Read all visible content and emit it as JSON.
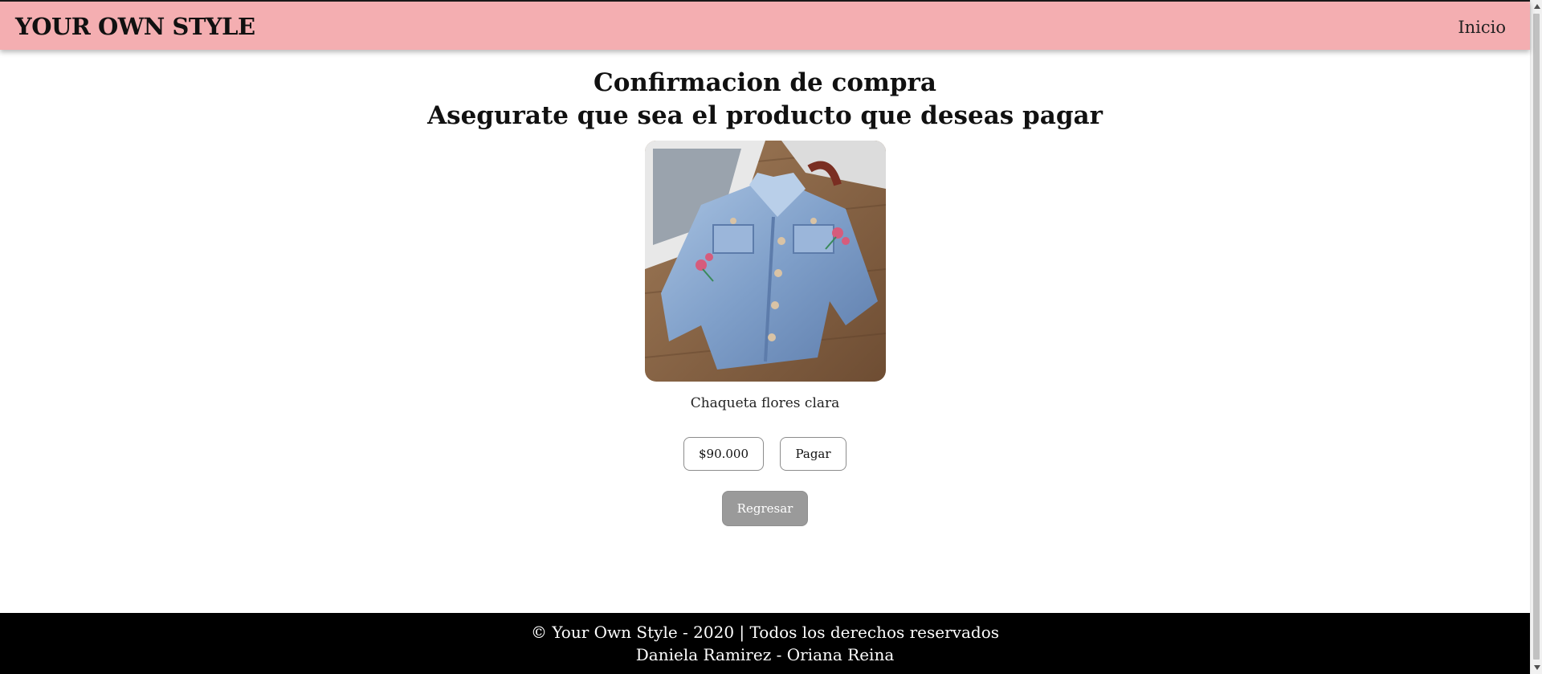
{
  "navbar": {
    "brand": "YOUR OWN STYLE",
    "link_home": "Inicio",
    "background_color": "#f4aeb1"
  },
  "main": {
    "title": "Confirmacion de compra",
    "subtitle": "Asegurate que sea el producto que deseas pagar",
    "product": {
      "name": "Chaqueta flores clara",
      "price": "$90.000",
      "image_icon": "denim-jacket-photo"
    },
    "buttons": {
      "pay": "Pagar",
      "back": "Regresar"
    }
  },
  "footer": {
    "line1": "© Your Own Style - 2020 | Todos los derechos reservados",
    "line2": "Daniela Ramirez - Oriana Reina",
    "background_color": "#000000"
  },
  "scrollbar": {
    "up_icon": "scroll-up-arrow-icon",
    "down_icon": "scroll-down-arrow-icon"
  }
}
